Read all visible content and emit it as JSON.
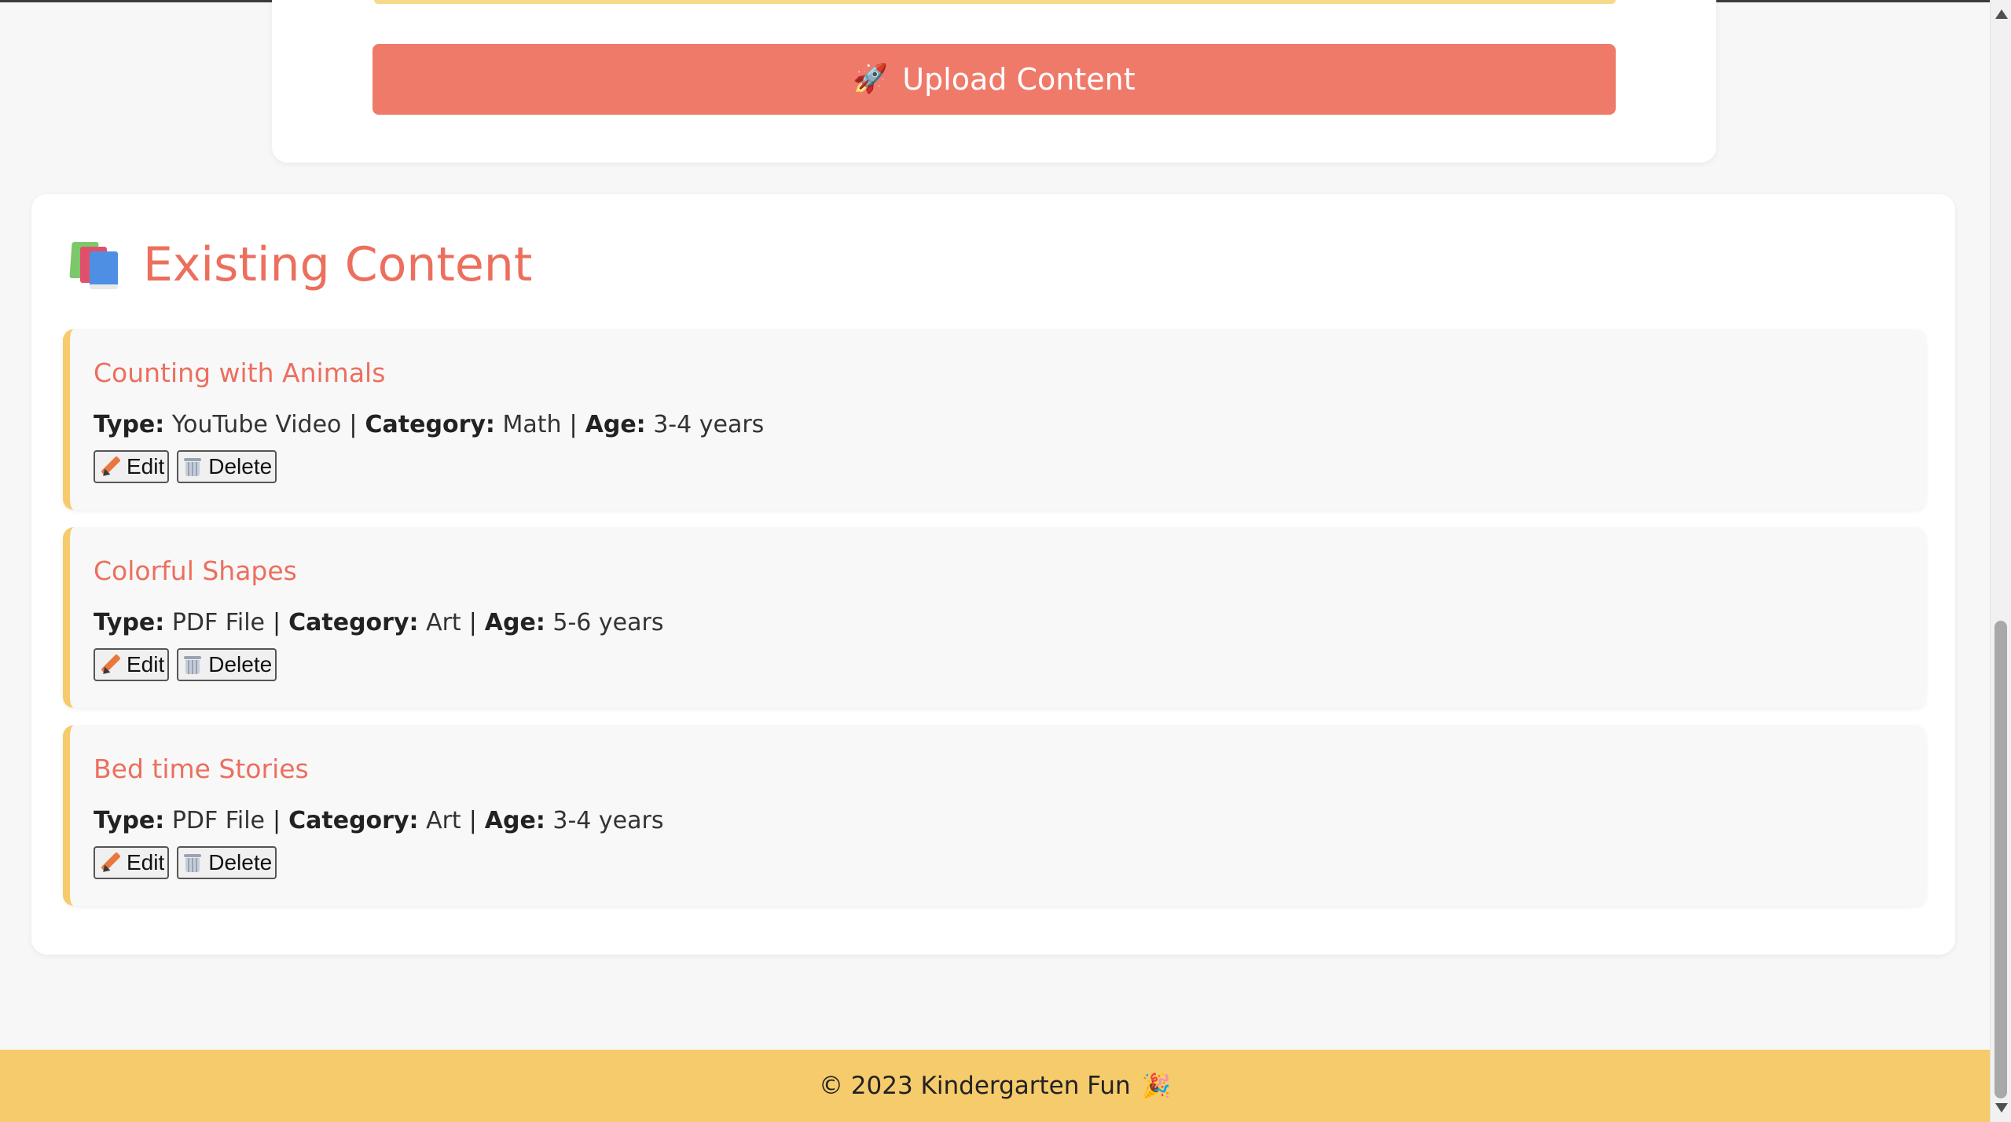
{
  "upload": {
    "button_icon": "🚀",
    "button_label": "Upload Content"
  },
  "existing": {
    "title_icon": "books-icon",
    "title": "Existing Content",
    "meta_labels": {
      "type": "Type:",
      "category": "Category:",
      "age": "Age:",
      "separator": "|"
    },
    "items": [
      {
        "title": "Counting with Animals",
        "type": "YouTube Video",
        "category": "Math",
        "age": "3-4 years",
        "edit_label": "Edit",
        "delete_label": "Delete"
      },
      {
        "title": "Colorful Shapes",
        "type": "PDF File",
        "category": "Art",
        "age": "5-6 years",
        "edit_label": "Edit",
        "delete_label": "Delete"
      },
      {
        "title": "Bed time Stories",
        "type": "PDF File",
        "category": "Art",
        "age": "3-4 years",
        "edit_label": "Edit",
        "delete_label": "Delete"
      }
    ]
  },
  "footer": {
    "text": "© 2023 Kindergarten Fun",
    "icon": "🎉"
  },
  "colors": {
    "accent": "#ec6f5e",
    "upload_button": "#ef7a6a",
    "highlight": "#f6cb6b",
    "background": "#f7f7f7"
  }
}
